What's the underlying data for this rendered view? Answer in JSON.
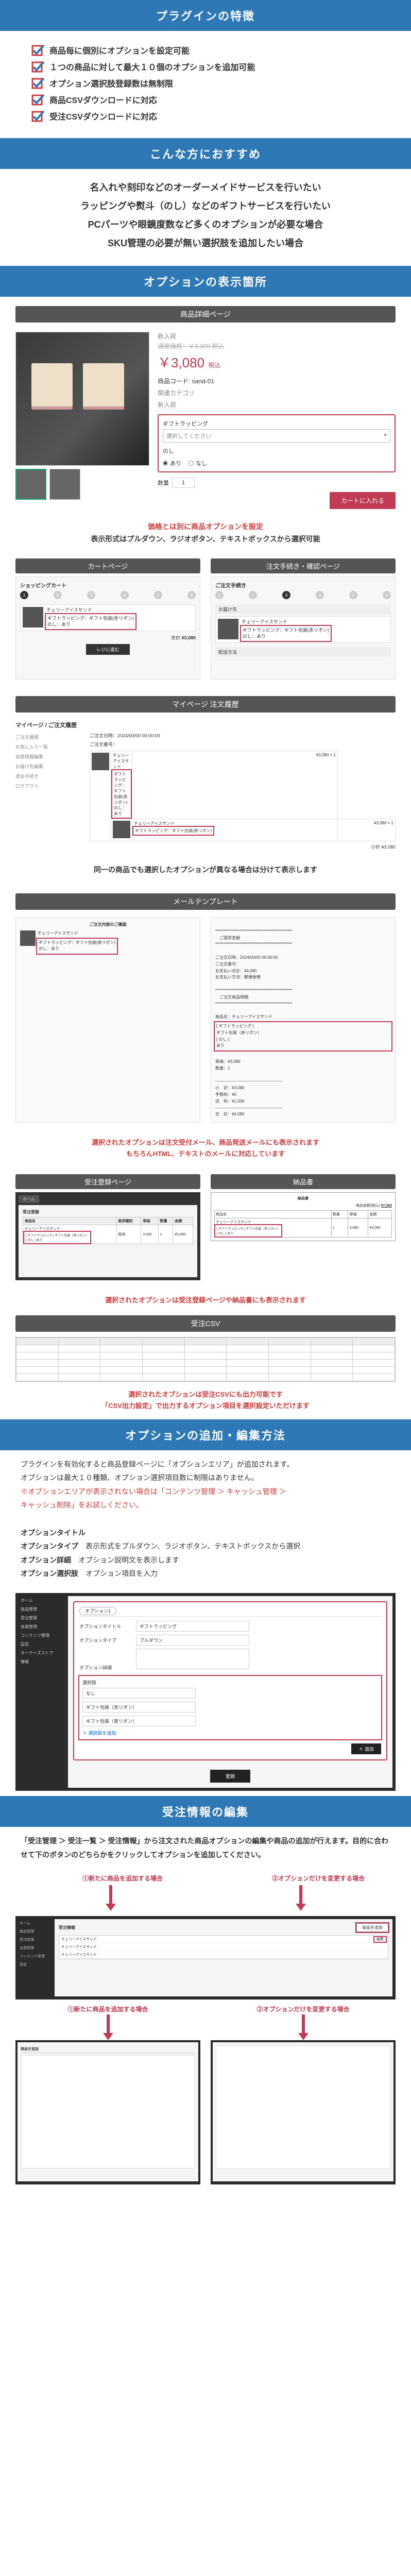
{
  "banners": {
    "features": "プラグインの特徴",
    "recommend": "こんな方におすすめ",
    "display": "オプションの表示箇所",
    "add_edit": "オプションの追加・編集方法",
    "order_edit": "受注情報の編集"
  },
  "checks": [
    "商品毎に個別にオプションを設定可能",
    "１つの商品に対して最大１０個のオプションを追加可能",
    "オプション選択肢登録数は無制限",
    "商品CSVダウンロードに対応",
    "受注CSVダウンロードに対応"
  ],
  "bold_lines": [
    "名入れや刻印などのオーダーメイドサービスを行いたい",
    "ラッピングや熨斗（のし）などのギフトサービスを行いたい",
    "PCパーツや眼鏡度数など多くのオプションが必要な場合",
    "SKU管理の必要が無い選択肢を追加したい場合"
  ],
  "sub": {
    "product_detail": "商品詳細ページ",
    "cart": "カートページ",
    "order_confirm": "注文手続き・確認ページ",
    "mypage": "マイページ 注文履歴",
    "mail": "メールテンプレート",
    "admin_order": "受注登録ページ",
    "invoice": "納品書",
    "csv": "受注CSV"
  },
  "product": {
    "category": "新入荷",
    "old_price": "通常価格：￥3,300 税込",
    "price": "￥3,080",
    "price_suffix": "税込",
    "code": "商品コード: sand-01",
    "tags_label": "関連カテゴリ",
    "tags": "新入荷  ",
    "opt_wrap_label": "ギフトラッピング",
    "opt_wrap_value": "選択してください",
    "opt_noshi_label": "のし",
    "radio_none": "なし",
    "radio_yes": "あり",
    "qty_label": "数量",
    "qty_val": "1",
    "cart_btn": "カートに入れる"
  },
  "notes": {
    "price_link": "価格とは別に商品オプションを設定",
    "display_types": "表示形式はプルダウン、ラジオボタン、テキストボックスから選択可能",
    "same_product": "同一の商品でも選択したオプションが異なる場合は分けて表示します",
    "mail_note1": "選択されたオプションは注文受付メール、商品発送メールにも表示されます",
    "mail_note2": "もちろんHTML、テキストのメールに対応しています",
    "admin_note": "選択されたオプションは受注登録ページや納品書にも表示されます",
    "csv_note1": "選択されたオプションは受注CSVにも出力可能です",
    "csv_note2": "「CSV出力設定」で出力するオプション項目を選択設定いただけます"
  },
  "cart_mock": {
    "title": "ショッピングカート",
    "steps": [
      "1",
      "2",
      "3",
      "4",
      "5",
      "6"
    ],
    "item_name": "チェリーアイスサンド",
    "opt1": "ギフトラッピング：ギフト包装(赤リボン)",
    "opt2": "のし：あり",
    "total_label": "合計",
    "total": "¥3,080",
    "btn": "レジに進む"
  },
  "confirm_mock": {
    "title": "ご注文手続き",
    "block": "お届け先",
    "shipping": "配送方法"
  },
  "mypage": {
    "title": "マイページ / ご注文履歴",
    "menu": [
      "ご注文履歴",
      "お気に入り一覧",
      "会員情報編集",
      "お届け先編集",
      "退会手続き",
      "ログアウト"
    ],
    "order_date_lbl": "ご注文日時：",
    "order_date": "2024/00/00 00:00:00",
    "order_no_lbl": "ご注文番号：",
    "ship_name": "チェリーアイスサンド",
    "opt_line1": "ギフトラッピング：ギフト包装(赤リボン)",
    "opt_line2": "のし：あり",
    "price_cell": "¥3,080 × 1",
    "subtotal": "小計  ¥3,080"
  },
  "mail": {
    "left_title": "ご注文内容のご確認",
    "left_body": "************************************************\n　ご請求金額\n************************************************\n\nご注文日時：2024/00/00 00:00:00\nご注文番号：\nお支払い合計：¥4,080\nお支払い方法：郵便振替\n\n************************************************\n　ご注文商品明細\n************************************************\n\n商品名：チェリーアイスサンド",
    "left_opt": "[ ギフトラッピング ]\nギフト包装（赤リボン）\n[ のし ]\nあり",
    "left_foot": "単価：¥3,080\n数量：1\n\n-------------------------------------------------\n小　計：¥3,080\n手数料：¥0\n送　料：¥1,000\n-------------------------------------------------\n合　計：¥4,080"
  },
  "admin": {
    "side": [
      "ホーム",
      "商品管理",
      "受注管理",
      "会員管理",
      "コンテンツ管理",
      "設定",
      "オーナーズストア",
      "情報"
    ],
    "title": "受注登録",
    "cols": [
      "商品名",
      "販売種別",
      "単価",
      "数量",
      "金額"
    ],
    "row": [
      "チェリーアイスサンド",
      "販売",
      "3,080",
      "1",
      "¥3,080"
    ],
    "opt_block": "[ ギフトラッピング ] ギフト包装（赤リボン）\n[ のし ] あり"
  },
  "invoice": {
    "title": "納品書",
    "total_lbl": "商品金額(税込)",
    "total": "¥7,360",
    "rows": [
      [
        "商品名",
        "数量",
        "単価",
        "金額"
      ],
      [
        "チェリーアイスサンド",
        "1",
        "3,080",
        "¥3,080"
      ]
    ],
    "opt_block": "[ ギフトラッピング ] ギフト包装（赤リボン）\n[ のし ] あり"
  },
  "add_edit_text": {
    "p1": "プラグインを有効化すると商品登録ページに「オプションエリア」が追加されます。",
    "p2": "オプションは最大１０種類、オプション選択項目数に制限はありません。",
    "p3a": "※オプションエリアが表示されない場合は「コンテンツ管理 ＞ キャッシュ管理 ＞",
    "p3b": "キャッシュ削除」をお試しください。",
    "h1": "オプションタイトル",
    "h2": "オプションタイプ",
    "h2_note": "表示形式をプルダウン、ラジオボタン、テキストボックスから選択",
    "h3": "オプション詳細",
    "h3_note": "オプション説明文を表示します",
    "h4": "オプション選択肢",
    "h4_note": "オプション項目を入力"
  },
  "opt_edit": {
    "tab": "オプション1",
    "f_title": "オプションタイトル",
    "f_title_v": "ギフトラッピング",
    "f_type": "オプションタイプ",
    "f_type_v": "プルダウン",
    "f_desc": "オプション詳細",
    "f_desc_v": "",
    "block_label": "選択肢",
    "opt_a": "なし",
    "opt_b": "ギフト包装（赤リボン）",
    "opt_c": "ギフト包装（青リボン）",
    "add_opt": "＋ 選択肢を追加",
    "add_block": "＋ 追加",
    "save": "登録"
  },
  "order_text": {
    "p1": "「受注管理 ＞ 受注一覧 ＞ 受注情報」から注文された商品オプションの編集や商品の追加が行えます。目的に合わせて下のボタンのどちらかをクリックしてオプションを追加してください。"
  },
  "callouts": {
    "add_product": "①新たに商品を追加する場合",
    "edit_option": "②オプションだけを変更する場合"
  },
  "order_panel": {
    "title": "受注情報",
    "btn_add": "商品を追加",
    "edit_link": "編集"
  }
}
